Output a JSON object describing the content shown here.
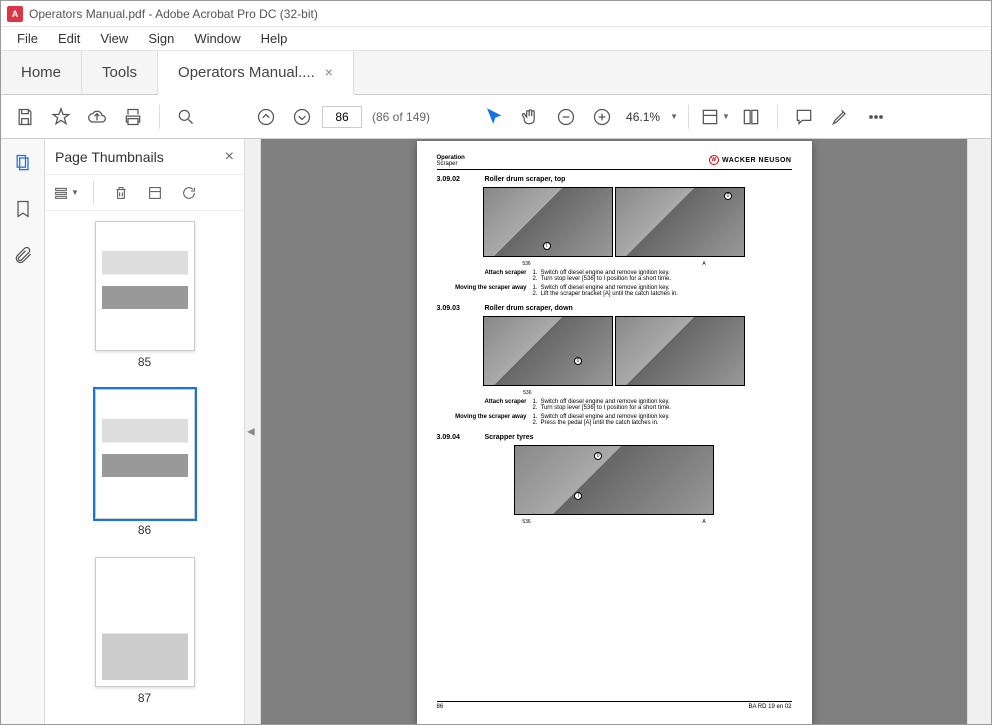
{
  "titlebar": {
    "icon_glyph": "A",
    "text": "Operators Manual.pdf - Adobe Acrobat Pro DC (32-bit)"
  },
  "menu": [
    "File",
    "Edit",
    "View",
    "Sign",
    "Window",
    "Help"
  ],
  "tabs": {
    "home": "Home",
    "tools": "Tools",
    "doc": "Operators Manual...."
  },
  "toolbar": {
    "page_current": "86",
    "page_total": "(86 of 149)",
    "zoom": "46.1%"
  },
  "thumbs": {
    "title": "Page Thumbnails",
    "pages": [
      "85",
      "86",
      "87"
    ]
  },
  "doc": {
    "header": {
      "section": "Operation",
      "subsection": "Scraper",
      "brand": "WACKER NEUSON"
    },
    "section1": {
      "num": "3.09.02",
      "title": "Roller drum scraper, top",
      "cap": "536"
    },
    "attach_label": "Attach scraper",
    "moving_label": "Moving the scraper away",
    "attach_step1": "Switch off diesel engine and remove ignition key.",
    "attach_step2": "Turn stop lever [536] to I position for a short time.",
    "moving_step1": "Switch off diesel engine and remove ignition key.",
    "moving_step2a": "Lift the scraper bracket [A] until the catch latches in.",
    "section2": {
      "num": "3.09.03",
      "title": "Roller drum scraper, down",
      "cap": "536"
    },
    "moving_step2b": "Press the pedal [A] until the catch latches in.",
    "section3": {
      "num": "3.09.04",
      "title": "Scrapper tyres",
      "cap": "536"
    },
    "footer": {
      "page": "86",
      "code": "BA RD 19 en 02"
    }
  }
}
